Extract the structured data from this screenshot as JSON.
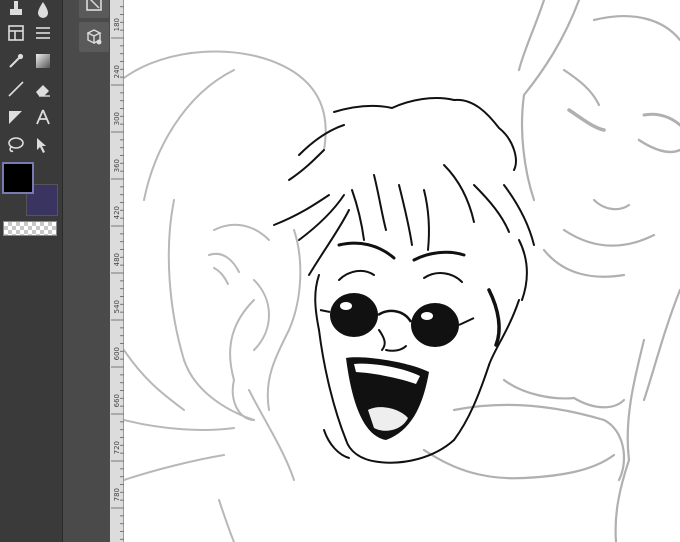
{
  "colors": {
    "foreground": "#000000",
    "background": "#3a3560"
  },
  "toolbox": {
    "tools": [
      {
        "name": "pen-icon"
      },
      {
        "name": "blend-icon"
      },
      {
        "name": "layout-icon"
      },
      {
        "name": "menu-lines-icon"
      },
      {
        "name": "eyedropper-icon"
      },
      {
        "name": "gradient-icon"
      },
      {
        "name": "line-icon"
      },
      {
        "name": "eraser-icon"
      },
      {
        "name": "shape-icon"
      },
      {
        "name": "text-icon"
      },
      {
        "name": "lasso-icon"
      },
      {
        "name": "select-arrow-icon"
      }
    ]
  },
  "subtools": [
    {
      "name": "frame-icon"
    },
    {
      "name": "layer-3d-icon"
    }
  ],
  "ruler": {
    "labels": [
      "180",
      "240",
      "300",
      "360",
      "420",
      "480",
      "540",
      "600",
      "660",
      "720",
      "780"
    ]
  }
}
